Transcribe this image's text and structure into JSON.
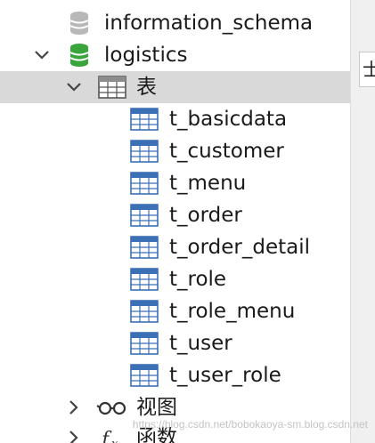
{
  "tree": {
    "db_above": "information_schema",
    "db_current": "logistics",
    "folder_tables": "表",
    "tables": [
      "t_basicdata",
      "t_customer",
      "t_menu",
      "t_order",
      "t_order_detail",
      "t_role",
      "t_role_menu",
      "t_user",
      "t_user_role"
    ],
    "folder_views": "视图",
    "folder_functions": "函数"
  },
  "right_tab_label": "士",
  "watermark": "https://blog.csdn.net/bobokaoya-sm.blog.csdn.net",
  "colors": {
    "selection": "#d9d9d9",
    "db_icon_active": "#3aa53a",
    "db_icon_inactive": "#b8b8b8",
    "table_icon_blue": "#3b6fb6"
  }
}
